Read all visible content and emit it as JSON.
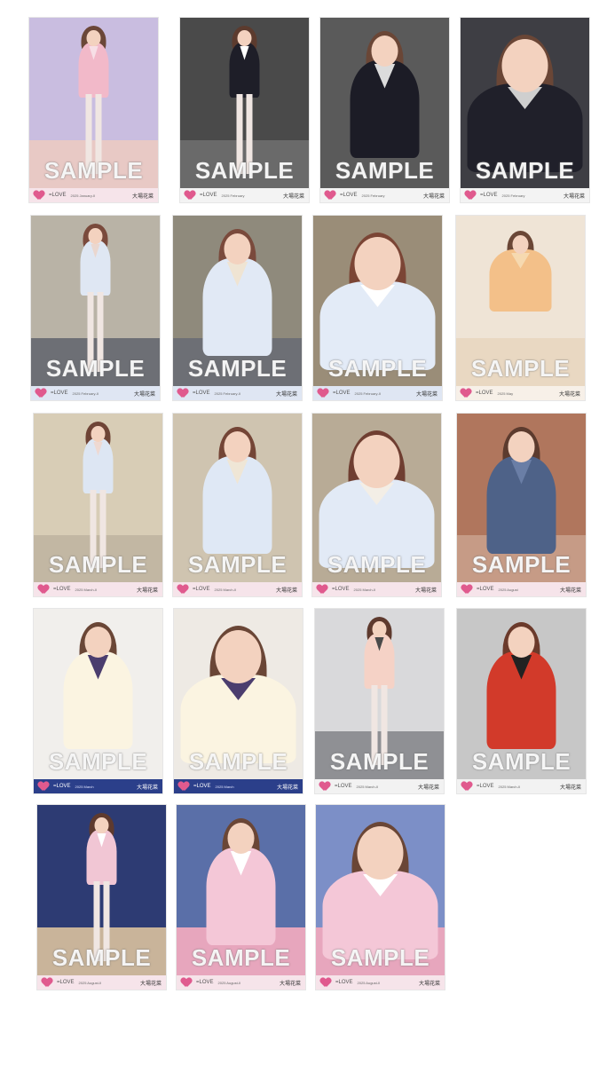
{
  "colors": {
    "background": "#ffffff",
    "logo_heart": "#e05a8e",
    "watermark": "#ffffff"
  },
  "card_common": {
    "watermark": "SAMPLE",
    "logo": "=LOVE",
    "member_name": "大場花菜"
  },
  "rows": [
    {
      "cards": [
        {
          "month": "2025 January-II",
          "bg": "#c9bde0",
          "floor": "#e8c9c5",
          "shot": "full",
          "hair": "#6b4738",
          "outfit": "#f2b9c9",
          "accent": "#f7dfe6",
          "footer": "#f6e4ea"
        },
        {
          "month": "2025 February",
          "bg": "#4a4a4a",
          "floor": "#6a6a6a",
          "shot": "full",
          "hair": "#5c3b2e",
          "outfit": "#1e1e28",
          "accent": "#ffffff",
          "footer": "#f3f3f3"
        },
        {
          "month": "2025 February",
          "bg": "#5a5a5a",
          "floor": "#5a5a5a",
          "shot": "half",
          "hair": "#6a4636",
          "outfit": "#1c1c26",
          "accent": "#dcdcdc",
          "footer": "#f3f3f3"
        },
        {
          "month": "2025 February",
          "bg": "#3e3e44",
          "floor": "#3e3e44",
          "shot": "close",
          "hair": "#6a4636",
          "outfit": "#20202a",
          "accent": "#cfcfcf",
          "footer": "#f3f3f3"
        }
      ]
    },
    {
      "cards": [
        {
          "month": "2025 February-II",
          "bg": "#b9b3a6",
          "floor": "#6d6f75",
          "shot": "full",
          "hair": "#7a4a3c",
          "outfit": "#dfe7f3",
          "accent": "#ead7cf",
          "footer": "#dfe6f3"
        },
        {
          "month": "2025 February-II",
          "bg": "#8f8a7c",
          "floor": "#6d6f75",
          "shot": "half",
          "hair": "#7a4a3c",
          "outfit": "#e1e9f5",
          "accent": "#efe4d3",
          "footer": "#dfe6f3"
        },
        {
          "month": "2025 February-II",
          "bg": "#9a8d78",
          "floor": "#9a8d78",
          "shot": "close",
          "hair": "#7b4535",
          "outfit": "#e3ebf7",
          "accent": "#ffffff",
          "footer": "#dfe6f3"
        },
        {
          "month": "2025 May",
          "bg": "#efe4d6",
          "floor": "#e9d8c2",
          "shot": "sit",
          "hair": "#6a4636",
          "outfit": "#f3c089",
          "accent": "#f6d9b0",
          "footer": "#f7f0e8"
        }
      ]
    },
    {
      "cards": [
        {
          "month": "2025 March-II",
          "bg": "#d8cdb6",
          "floor": "#c2b7a3",
          "shot": "full",
          "hair": "#6f4436",
          "outfit": "#dde6f3",
          "accent": "#eed9d2",
          "footer": "#f6e4ea"
        },
        {
          "month": "2025 March-II",
          "bg": "#cfc4b0",
          "floor": "#cfc4b0",
          "shot": "half",
          "hair": "#744536",
          "outfit": "#dfe8f5",
          "accent": "#efe6d6",
          "footer": "#f6e4ea"
        },
        {
          "month": "2025 March-II",
          "bg": "#b8ab96",
          "floor": "#b8ab96",
          "shot": "close",
          "hair": "#6f3e31",
          "outfit": "#e2eaf6",
          "accent": "#f3eee6",
          "footer": "#f6e4ea"
        },
        {
          "month": "2025 August",
          "bg": "#b0765d",
          "floor": "#c69b86",
          "shot": "half",
          "hair": "#5c3b2e",
          "outfit": "#4e6288",
          "accent": "#6a7ea6",
          "footer": "#f6e4ea"
        }
      ]
    },
    {
      "cards": [
        {
          "month": "2025 March",
          "bg": "#f1efec",
          "floor": "#f1efec",
          "shot": "half",
          "hair": "#6a4636",
          "outfit": "#fbf4e1",
          "accent": "#4b3d6e",
          "footer": "#2b3f8a"
        },
        {
          "month": "2025 March",
          "bg": "#eeeae4",
          "floor": "#eeeae4",
          "shot": "close",
          "hair": "#6a4636",
          "outfit": "#fbf4e1",
          "accent": "#4b3d6e",
          "footer": "#2b3f8a"
        },
        {
          "month": "2025 March-II",
          "bg": "#d9d9db",
          "floor": "#8f9094",
          "shot": "full",
          "hair": "#5e3a2e",
          "outfit": "#f5d2c6",
          "accent": "#4a4a4a",
          "footer": "#f2f2f2"
        },
        {
          "month": "2025 March-II",
          "bg": "#c7c7c7",
          "floor": "#c7c7c7",
          "shot": "half",
          "hair": "#6b3a2b",
          "outfit": "#d23a2a",
          "accent": "#222222",
          "footer": "#f2f2f2"
        }
      ]
    },
    {
      "cards": [
        {
          "month": "2025 August-II",
          "bg": "#2d3b73",
          "floor": "#c9b49a",
          "shot": "full",
          "hair": "#5e3a2e",
          "outfit": "#f1c6d4",
          "accent": "#ffffff",
          "footer": "#f6e4ea"
        },
        {
          "month": "2025 August-II",
          "bg": "#5a6fa8",
          "floor": "#e7a6bd",
          "shot": "half",
          "hair": "#6a4636",
          "outfit": "#f4c7d7",
          "accent": "#ffffff",
          "footer": "#f6e4ea"
        },
        {
          "month": "2025 August-II",
          "bg": "#7c8fc7",
          "floor": "#e7a6bd",
          "shot": "close",
          "hair": "#6a4636",
          "outfit": "#f4c7d7",
          "accent": "#ffffff",
          "footer": "#f6e4ea"
        }
      ]
    }
  ]
}
